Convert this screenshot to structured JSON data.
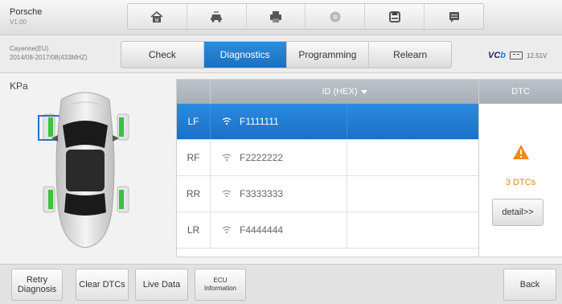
{
  "vehicle": {
    "make": "Porsche",
    "version": "V1.00"
  },
  "toolbar": {
    "icons": [
      "home-icon",
      "vehicle-icon",
      "print-icon",
      "help-icon",
      "save-icon",
      "message-icon"
    ]
  },
  "vehicle_info": {
    "model": "Cayenne(EU)",
    "details": "2014/08-2017/08(433MHZ)"
  },
  "tabs": [
    {
      "label": "Check",
      "active": false
    },
    {
      "label": "Diagnostics",
      "active": true
    },
    {
      "label": "Programming",
      "active": false
    },
    {
      "label": "Relearn",
      "active": false
    }
  ],
  "status": {
    "logo_main": "VC",
    "logo_accent": "b",
    "voltage": "12.51V"
  },
  "panel": {
    "unit": "KPa"
  },
  "table": {
    "header_id": "ID (HEX)",
    "rows": [
      {
        "position": "LF",
        "id": "F1111111",
        "selected": true
      },
      {
        "position": "RF",
        "id": "F2222222",
        "selected": false
      },
      {
        "position": "RR",
        "id": "F3333333",
        "selected": false
      },
      {
        "position": "LR",
        "id": "F4444444",
        "selected": false
      }
    ]
  },
  "dtc": {
    "header": "DTC",
    "count": "3 DTCs",
    "detail_label": "detail>>"
  },
  "bottom": {
    "retry": "Retry\nDiagnosis",
    "clear": "Clear DTCs",
    "live": "Live Data",
    "ecu": "ECU\nInformation",
    "back": "Back"
  },
  "colors": {
    "accent": "#1f7bd1",
    "sensor_green": "#3cc23c",
    "warning": "#f08a1a"
  }
}
